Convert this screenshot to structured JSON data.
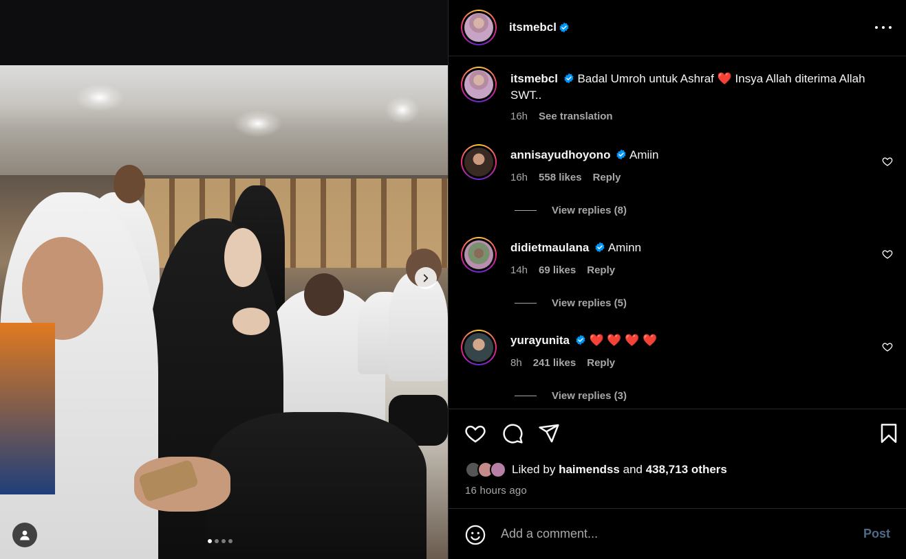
{
  "post": {
    "author": "itsmebcl",
    "author_verified": true,
    "caption": "Badal Umroh untuk Ashraf",
    "caption_heart": "❤️",
    "caption_rest": "Insya Allah diterima Allah SWT..",
    "caption_time": "16h",
    "see_translation": "See translation",
    "carousel_pages": 4,
    "carousel_current": 1
  },
  "comments": [
    {
      "user": "annisayudhoyono",
      "text": "Amiin",
      "time": "16h",
      "likes": "558 likes",
      "reply": "Reply",
      "view_replies": "View replies (8)"
    },
    {
      "user": "didietmaulana",
      "text": "Aminn",
      "time": "14h",
      "likes": "69 likes",
      "reply": "Reply",
      "view_replies": "View replies (5)"
    },
    {
      "user": "yurayunita",
      "text": "❤️ ❤️ ❤️ ❤️",
      "time": "8h",
      "likes": "241 likes",
      "reply": "Reply",
      "view_replies": "View replies (3)"
    }
  ],
  "likes": {
    "prefix": "Liked by",
    "user": "haimendss",
    "middle": "and",
    "others": "438,713 others"
  },
  "post_time": "16 hours ago",
  "add_comment": {
    "placeholder": "Add a comment...",
    "post_label": "Post"
  },
  "colors": {
    "verified": "#0095f6",
    "heart": "#ff2d44",
    "post_disabled": "#4f6a86",
    "muted_text": "#a8a8a8"
  },
  "icons": [
    "more-icon",
    "verified-icon",
    "heart-icon",
    "comment-icon",
    "share-icon",
    "bookmark-icon",
    "emoji-icon",
    "chevron-right-icon",
    "user-tag-icon"
  ]
}
